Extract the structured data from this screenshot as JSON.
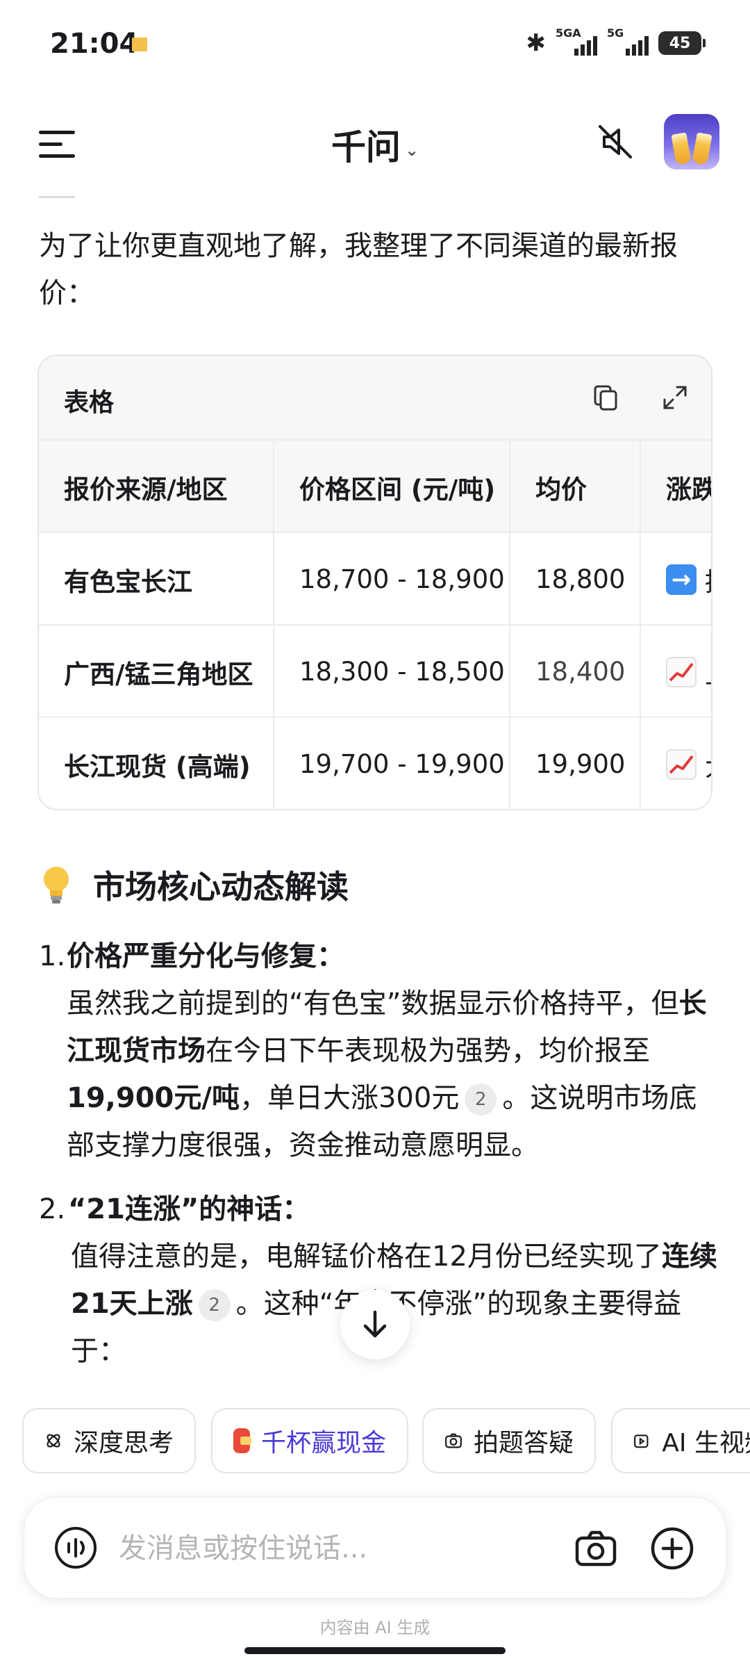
{
  "status": {
    "time": "21:04",
    "sig1_tag": "5GA",
    "sig2_tag": "5G",
    "battery": "45"
  },
  "header": {
    "title": "千问",
    "caret": "⌄"
  },
  "intro": "为了让你更直观地了解，我整理了不同渠道的最新报价：",
  "table": {
    "title": "表格",
    "headers": [
      "报价来源/地区",
      "价格区间 (元/吨)",
      "均价",
      "涨跌"
    ],
    "rows": [
      {
        "source": "有色宝长江",
        "range": "18,700 - 18,900",
        "avg": "18,800",
        "trend": "持平"
      },
      {
        "source": "广西/锰三角地区",
        "range": "18,300 - 18,500",
        "avg": "18,400",
        "trend": "上涨"
      },
      {
        "source": "长江现货 (高端)",
        "range": "19,700 - 19,900",
        "avg": "19,900",
        "trend": "大涨"
      }
    ]
  },
  "section": {
    "title": "市场核心动态解读"
  },
  "list": [
    {
      "num": "1.",
      "title": "价格严重分化与修复：",
      "p1": "虽然我之前提到的“有色宝”数据显示价格持平，但",
      "b1": "长江现货市场",
      "p2": "在今日下午表现极为强势，均价报至",
      "b2": "19,900元/吨",
      "p3": "，单日大涨300元",
      "cite": "2",
      "p4": "。这说明市场底部支撑力度很强，资金推动意愿明显。"
    },
    {
      "num": "2.",
      "title": "“21连涨”的神话：",
      "p1": "值得注意的是，电解锰价格在12月份已经实现了",
      "b1": "连续21天上涨",
      "cite": "2",
      "p2": "。这种“年末不停涨”的现象主要得益于："
    }
  ],
  "chips": [
    {
      "label": "深度思考"
    },
    {
      "label": "千杯赢现金"
    },
    {
      "label": "拍题答疑"
    },
    {
      "label": "AI 生视频"
    }
  ],
  "input": {
    "placeholder": "发消息或按住说话..."
  },
  "footer": "内容由 AI 生成",
  "colors": {
    "accent": "#4a3ad6",
    "text": "#1b1b1f",
    "border": "#e6e6e6"
  }
}
